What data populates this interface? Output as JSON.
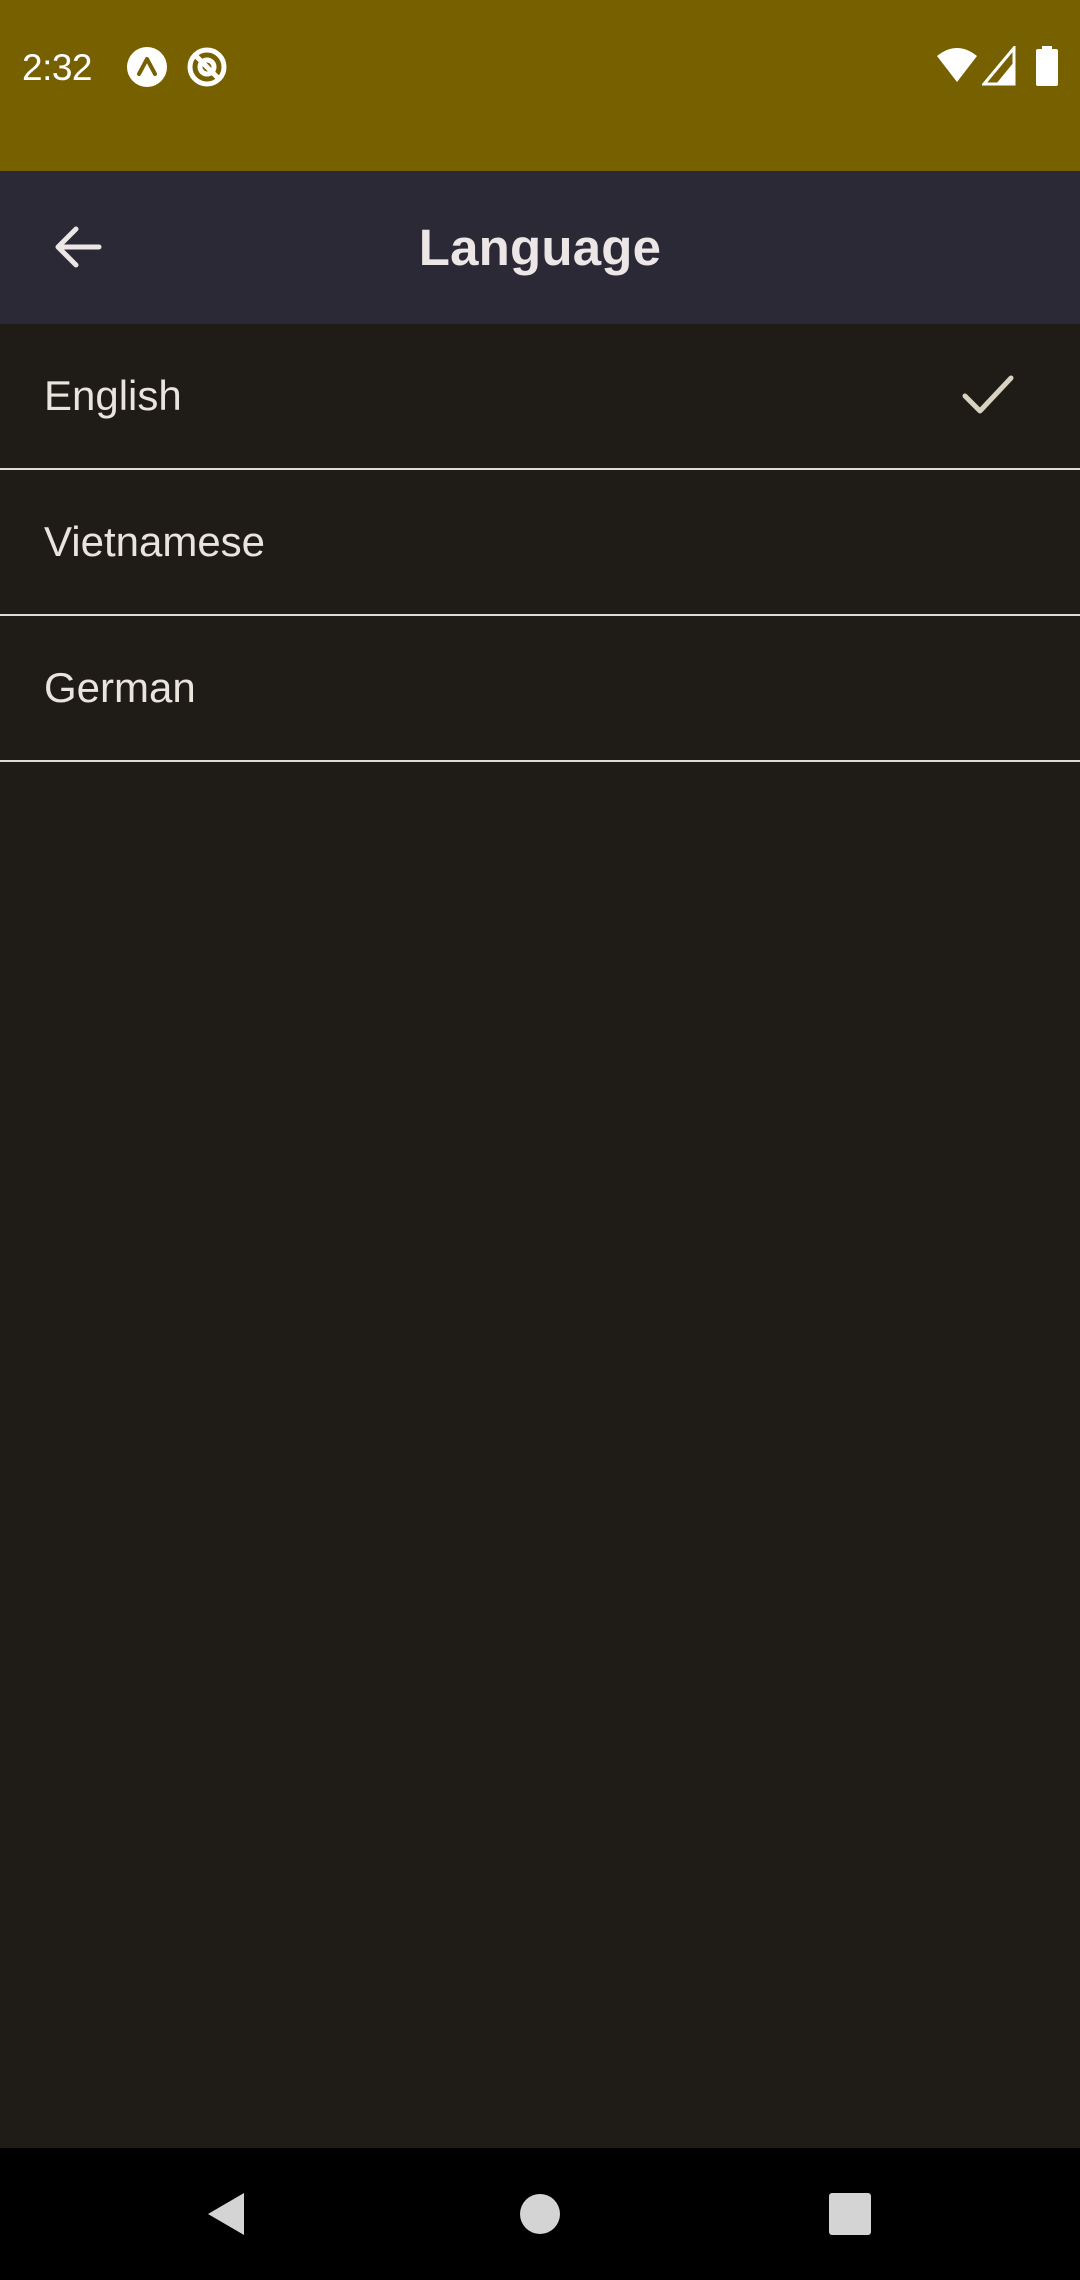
{
  "status_bar": {
    "time": "2:32",
    "background": "#776000",
    "left_icons": [
      "app-notification-icon",
      "at-sign-notification-icon"
    ],
    "right_icons": [
      "wifi-icon",
      "cellular-signal-icon",
      "battery-icon"
    ]
  },
  "app_bar": {
    "title": "Language",
    "background": "#2a2935",
    "back_icon": "arrow-left-icon"
  },
  "languages": [
    {
      "label": "English",
      "selected": true
    },
    {
      "label": "Vietnamese",
      "selected": false
    },
    {
      "label": "German",
      "selected": false
    }
  ],
  "colors": {
    "page_background": "#1f1c18",
    "divider": "#dcdcdc",
    "check": "#d8d2c0"
  },
  "nav_bar": {
    "buttons": [
      "back-triangle-icon",
      "home-circle-icon",
      "recents-square-icon"
    ]
  }
}
